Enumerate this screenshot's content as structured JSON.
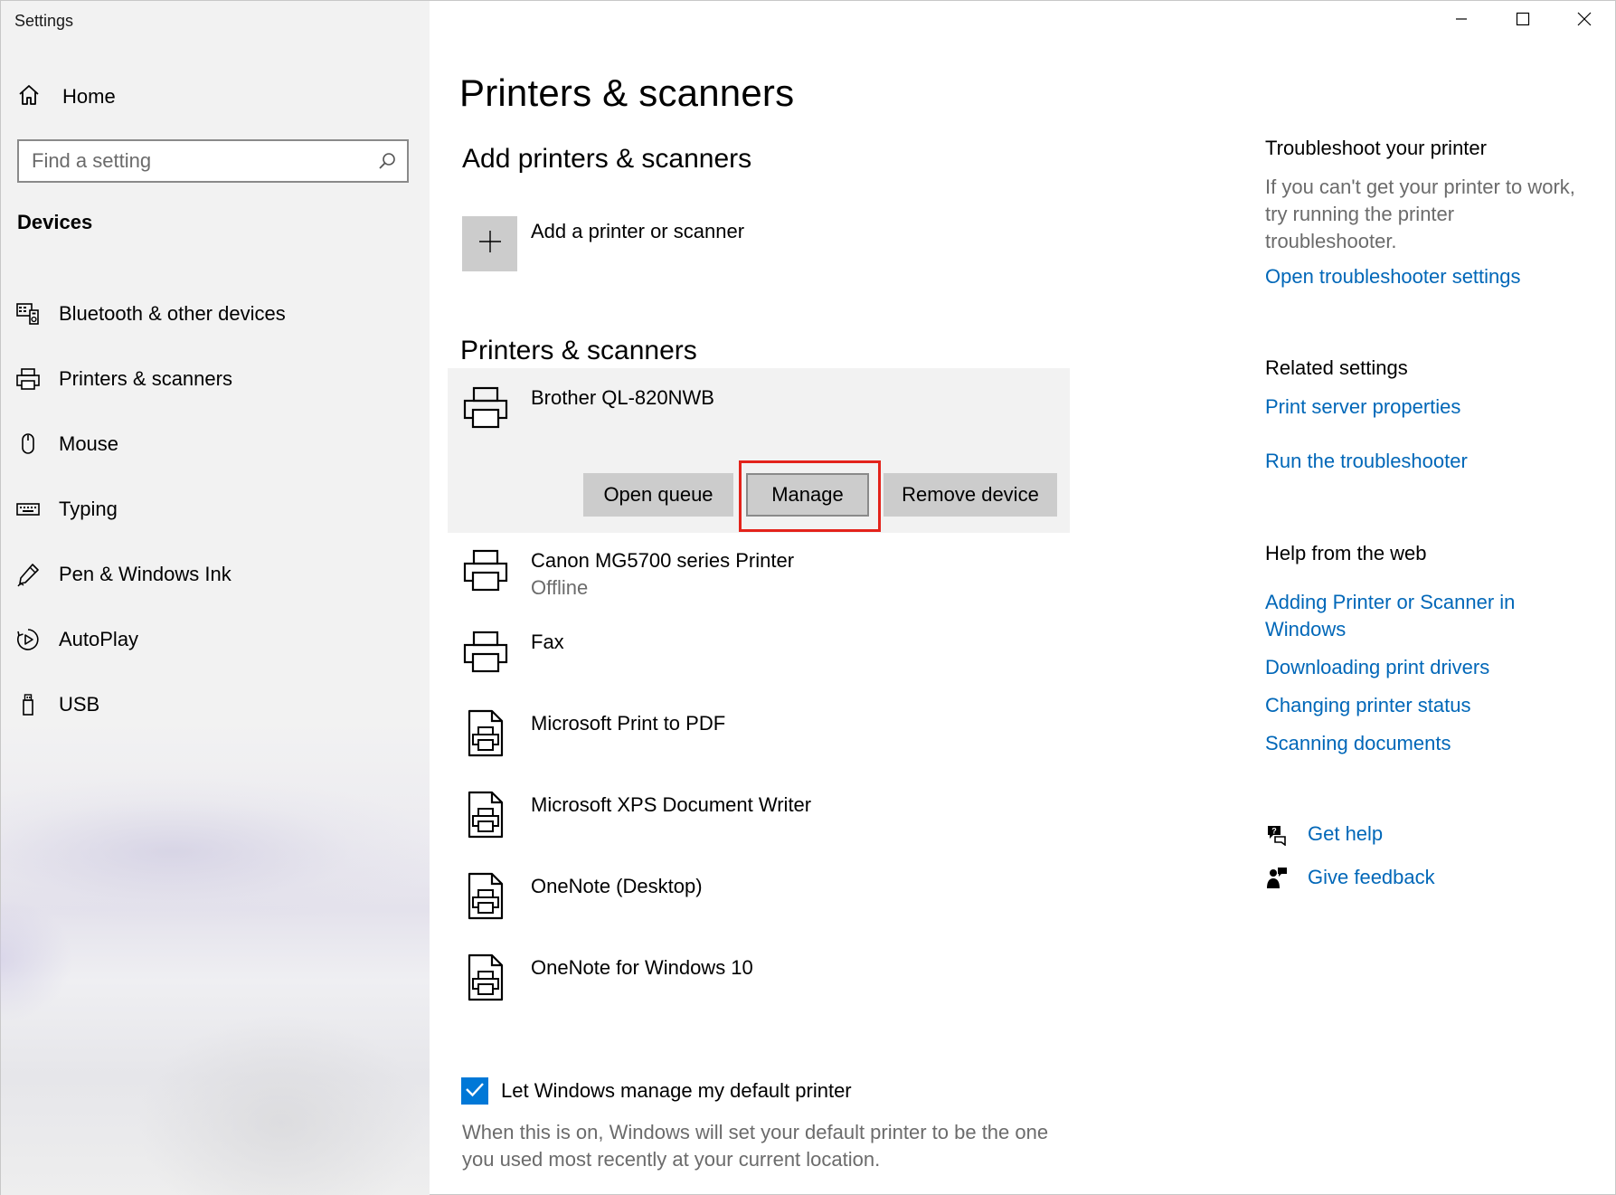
{
  "window": {
    "title": "Settings"
  },
  "sidebar": {
    "home_label": "Home",
    "search_placeholder": "Find a setting",
    "section_label": "Devices",
    "items": [
      {
        "label": "Bluetooth & other devices",
        "icon": "bluetooth-devices-icon"
      },
      {
        "label": "Printers & scanners",
        "icon": "printer-icon"
      },
      {
        "label": "Mouse",
        "icon": "mouse-icon"
      },
      {
        "label": "Typing",
        "icon": "keyboard-icon"
      },
      {
        "label": "Pen & Windows Ink",
        "icon": "pen-icon"
      },
      {
        "label": "AutoPlay",
        "icon": "autoplay-icon"
      },
      {
        "label": "USB",
        "icon": "usb-icon"
      }
    ]
  },
  "main": {
    "title": "Printers & scanners",
    "add_section_title": "Add printers & scanners",
    "add_label": "Add a printer or scanner",
    "list_title": "Printers & scanners",
    "devices": [
      {
        "name": "Brother QL-820NWB",
        "status": "",
        "icon": "printer-icon"
      },
      {
        "name": "Canon MG5700 series Printer",
        "status": "Offline",
        "icon": "printer-icon"
      },
      {
        "name": "Fax",
        "status": "",
        "icon": "printer-icon"
      },
      {
        "name": "Microsoft Print to PDF",
        "status": "",
        "icon": "document-printer-icon"
      },
      {
        "name": "Microsoft XPS Document Writer",
        "status": "",
        "icon": "document-printer-icon"
      },
      {
        "name": "OneNote (Desktop)",
        "status": "",
        "icon": "document-printer-icon"
      },
      {
        "name": "OneNote for Windows 10",
        "status": "",
        "icon": "document-printer-icon"
      }
    ],
    "buttons": {
      "open_queue": "Open queue",
      "manage": "Manage",
      "remove_device": "Remove device"
    },
    "default_printer": {
      "checked": true,
      "label": "Let Windows manage my default printer",
      "description": "When this is on, Windows will set your default printer to be the one you used most recently at your current location."
    }
  },
  "right": {
    "troubleshoot": {
      "title": "Troubleshoot your printer",
      "text": "If you can't get your printer to work, try running the printer troubleshooter.",
      "link": "Open troubleshooter settings"
    },
    "related": {
      "title": "Related settings",
      "links": [
        "Print server properties",
        "Run the troubleshooter"
      ]
    },
    "help_web": {
      "title": "Help from the web",
      "links": [
        "Adding Printer or Scanner in Windows",
        "Downloading print drivers",
        "Changing printer status",
        "Scanning documents"
      ]
    },
    "get_help": "Get help",
    "give_feedback": "Give feedback"
  },
  "colors": {
    "accent": "#0067b8",
    "checkbox": "#0078d7",
    "highlight": "#e3231b",
    "button": "#cccccc"
  }
}
